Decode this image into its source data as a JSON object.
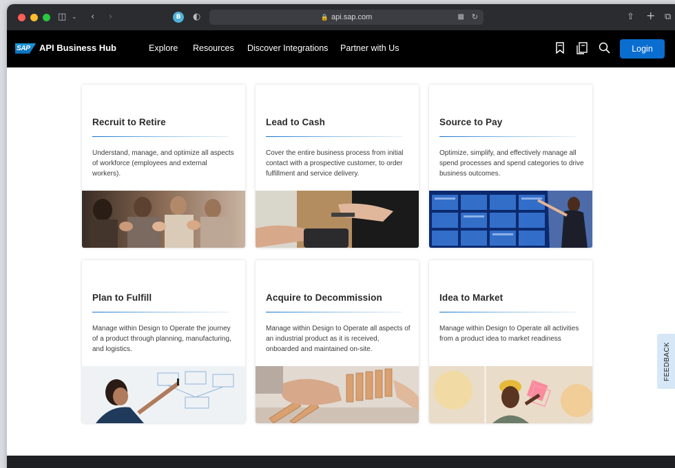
{
  "browser": {
    "url": "api.sap.com",
    "traffic_colors": [
      "#ff5f57",
      "#febc2e",
      "#28c840"
    ]
  },
  "nav": {
    "brand": "API Business Hub",
    "logo_text": "SAP",
    "links": [
      "Explore",
      "Resources",
      "Discover Integrations",
      "Partner with Us"
    ],
    "login_label": "Login"
  },
  "cards": [
    {
      "title": "Recruit to Retire",
      "description": "Understand, manage, and optimize all aspects of workforce (employees and external workers).",
      "image": "people-applauding"
    },
    {
      "title": "Lead to Cash",
      "description": "Cover the entire business process from initial contact with a prospective customer, to order fulfillment and service delivery.",
      "image": "card-payment"
    },
    {
      "title": "Source to Pay",
      "description": "Optimize, simplify, and effectively manage all spend processes and spend categories to drive business outcomes.",
      "image": "data-wall-presentation"
    },
    {
      "title": "Plan to Fulfill",
      "description": "Manage within Design to Operate the journey of a product through planning, manufacturing, and logistics.",
      "image": "whiteboard-planning"
    },
    {
      "title": "Acquire to Decommission",
      "description": "Manage within Design to Operate all aspects of an industrial product as it is received, onboarded and maintained on-site.",
      "image": "domino-blocks"
    },
    {
      "title": "Idea to Market",
      "description": "Manage within Design to Operate all activities from a product idea to market readiness",
      "image": "person-holding-cube"
    }
  ],
  "feedback_label": "FEEDBACK"
}
